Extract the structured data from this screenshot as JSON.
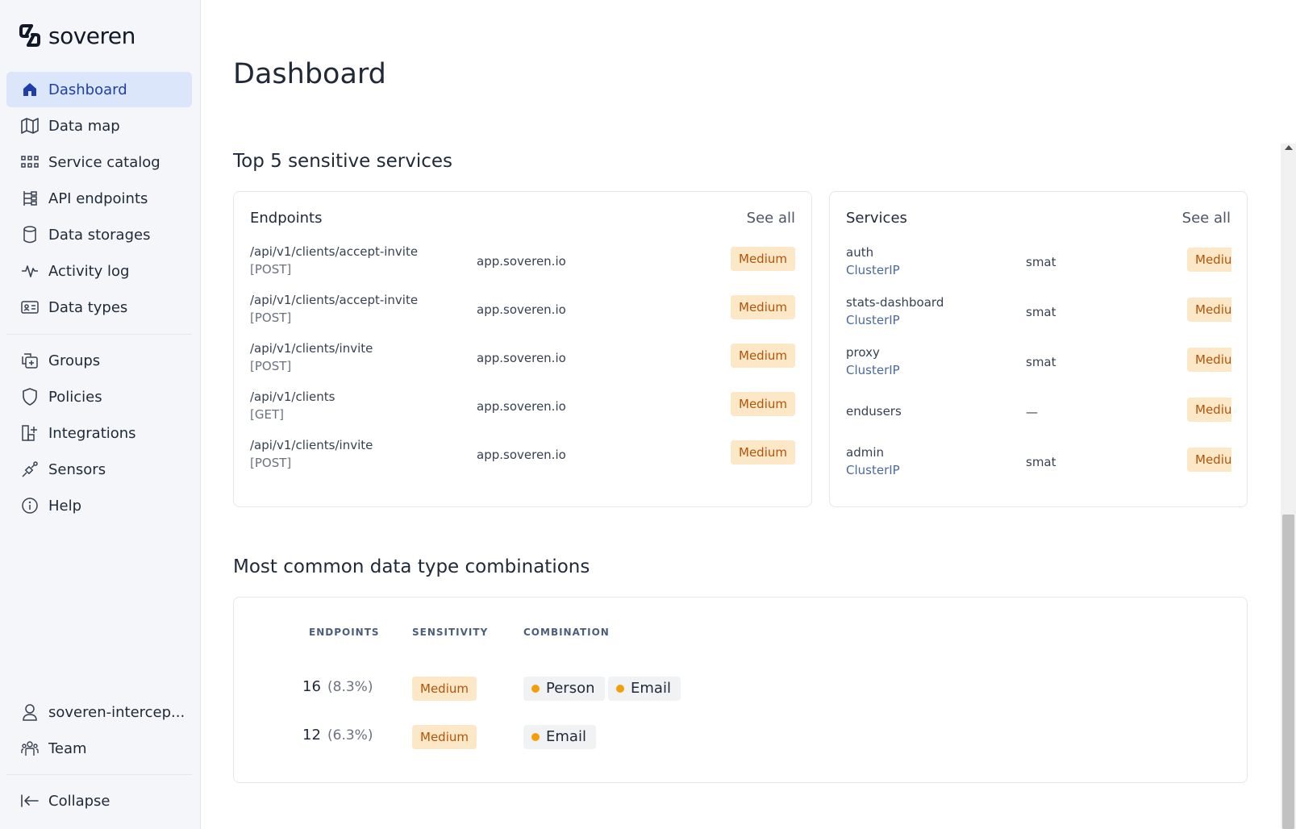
{
  "brand": {
    "name": "soveren"
  },
  "sidebar": {
    "main_items": [
      {
        "label": "Dashboard",
        "icon": "home-icon",
        "active": true
      },
      {
        "label": "Data map",
        "icon": "map-icon"
      },
      {
        "label": "Service catalog",
        "icon": "grid-icon"
      },
      {
        "label": "API endpoints",
        "icon": "api-endpoints-icon"
      },
      {
        "label": "Data storages",
        "icon": "database-icon"
      },
      {
        "label": "Activity log",
        "icon": "activity-icon"
      },
      {
        "label": "Data types",
        "icon": "id-card-icon"
      }
    ],
    "secondary_items": [
      {
        "label": "Groups",
        "icon": "groups-icon"
      },
      {
        "label": "Policies",
        "icon": "shield-icon"
      },
      {
        "label": "Integrations",
        "icon": "integrations-icon"
      },
      {
        "label": "Sensors",
        "icon": "sensor-icon"
      },
      {
        "label": "Help",
        "icon": "info-icon"
      }
    ],
    "account": {
      "label": "soveren-intercep...",
      "icon": "user-icon"
    },
    "team": {
      "label": "Team",
      "icon": "team-icon"
    },
    "collapse": {
      "label": "Collapse",
      "icon": "collapse-icon"
    }
  },
  "main": {
    "title": "Dashboard",
    "top_services": {
      "title": "Top 5 sensitive services",
      "endpoints": {
        "title": "Endpoints",
        "see_all": "See all",
        "rows": [
          {
            "path": "/api/v1/clients/accept-invite",
            "method": "[POST]",
            "host": "app.soveren.io",
            "sensitivity": "Medium"
          },
          {
            "path": "/api/v1/clients/accept-invite",
            "method": "[POST]",
            "host": "app.soveren.io",
            "sensitivity": "Medium"
          },
          {
            "path": "/api/v1/clients/invite",
            "method": "[POST]",
            "host": "app.soveren.io",
            "sensitivity": "Medium"
          },
          {
            "path": "/api/v1/clients",
            "method": "[GET]",
            "host": "app.soveren.io",
            "sensitivity": "Medium"
          },
          {
            "path": "/api/v1/clients/invite",
            "method": "[POST]",
            "host": "app.soveren.io",
            "sensitivity": "Medium"
          }
        ]
      },
      "services": {
        "title": "Services",
        "see_all": "See all",
        "rows": [
          {
            "name": "auth",
            "type": "ClusterIP",
            "namespace": "smat",
            "sensitivity": "Medium"
          },
          {
            "name": "stats-dashboard",
            "type": "ClusterIP",
            "namespace": "smat",
            "sensitivity": "Medium"
          },
          {
            "name": "proxy",
            "type": "ClusterIP",
            "namespace": "smat",
            "sensitivity": "Medium"
          },
          {
            "name": "endusers",
            "type": "",
            "namespace": "—",
            "sensitivity": "Medium"
          },
          {
            "name": "admin",
            "type": "ClusterIP",
            "namespace": "smat",
            "sensitivity": "Medium"
          }
        ]
      }
    },
    "combinations": {
      "title": "Most common data type combinations",
      "headers": {
        "endpoints": "ENDPOINTS",
        "sensitivity": "SENSITIVITY",
        "combination": "COMBINATION"
      },
      "rows": [
        {
          "count": "16",
          "percent": "(8.3%)",
          "sensitivity": "Medium",
          "types": [
            "Person",
            "Email"
          ]
        },
        {
          "count": "12",
          "percent": "(6.3%)",
          "sensitivity": "Medium",
          "types": [
            "Email"
          ]
        }
      ]
    }
  },
  "colors": {
    "accent": "#1f3fa8",
    "active_bg": "#dbe6fa",
    "badge_bg": "#fce7c6",
    "badge_text": "#b45309",
    "dot": "#f59e0b"
  }
}
